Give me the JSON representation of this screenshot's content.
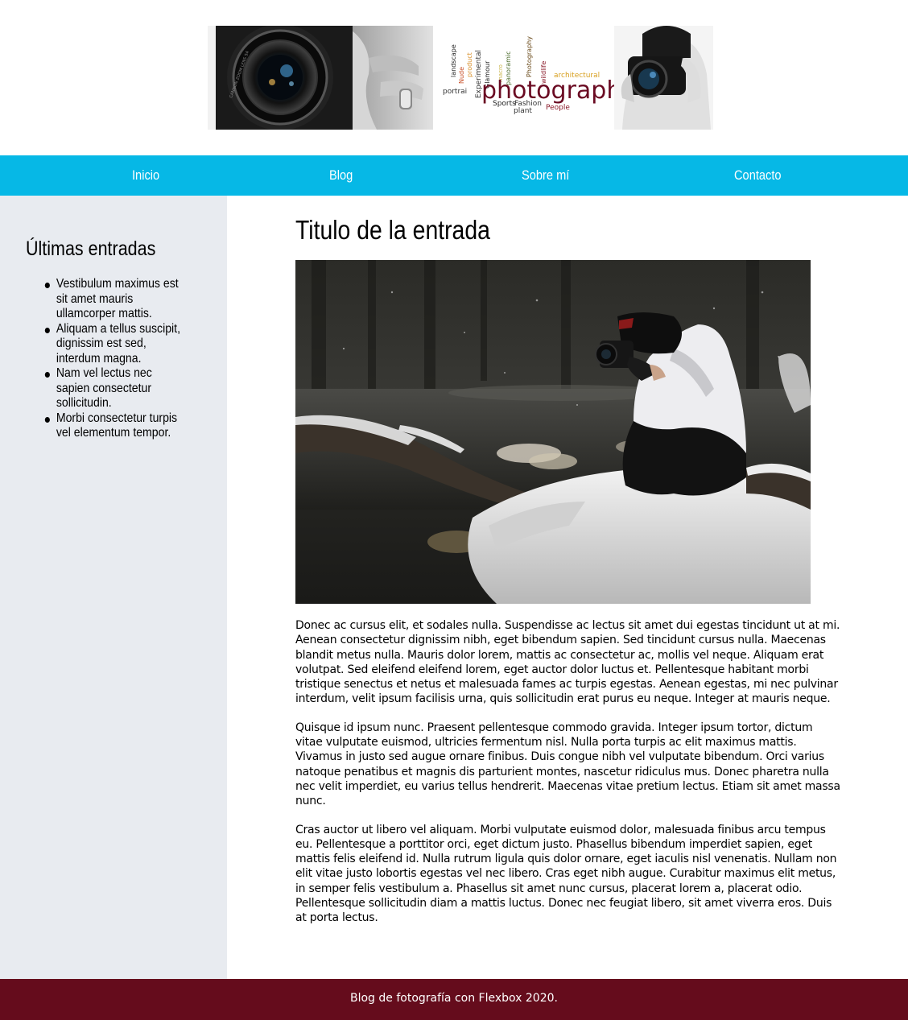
{
  "banner": {
    "alt": "photography banner",
    "word_cloud": [
      "landscape",
      "portrai",
      "Nude",
      "product",
      "Experimental",
      "Glamour",
      "macro",
      "panoramic",
      "Photography",
      "wildlife",
      "architectural",
      "photography",
      "Sports",
      "Fashion",
      "plant",
      "People"
    ],
    "lens_text": "CANNON ZOOM LENS 54"
  },
  "nav": {
    "items": [
      {
        "label": "Inicio"
      },
      {
        "label": "Blog"
      },
      {
        "label": "Sobre mí"
      },
      {
        "label": "Contacto"
      }
    ],
    "color": "#06b8e6"
  },
  "sidebar": {
    "title": "Últimas entradas",
    "items": [
      {
        "text": "Vestibulum maximus est sit amet mauris ullamcorper mattis."
      },
      {
        "text": "Aliquam a tellus suscipit, dignissim est sed, interdum magna."
      },
      {
        "text": "Nam vel lectus nec sapien consectetur sollicitudin."
      },
      {
        "text": "Morbi consectetur turpis vel elementum tempor."
      }
    ],
    "background": "#e8ebf0"
  },
  "post": {
    "title": "Titulo de la entrada",
    "image_alt": "photographer crouching on snowy log by a river",
    "paragraphs": [
      "Donec ac cursus elit, et sodales nulla. Suspendisse ac lectus sit amet dui egestas tincidunt ut at mi. Aenean consectetur dignissim nibh, eget bibendum sapien. Sed tincidunt cursus nulla. Maecenas blandit metus nulla. Mauris dolor lorem, mattis ac consectetur ac, mollis vel neque. Aliquam erat volutpat. Sed eleifend eleifend lorem, eget auctor dolor luctus et. Pellentesque habitant morbi tristique senectus et netus et malesuada fames ac turpis egestas. Aenean egestas, mi nec pulvinar interdum, velit ipsum facilisis urna, quis sollicitudin erat purus eu neque. Integer at mauris neque.",
      "Quisque id ipsum nunc. Praesent pellentesque commodo gravida. Integer ipsum tortor, dictum vitae vulputate euismod, ultricies fermentum nisl. Nulla porta turpis ac elit maximus mattis. Vivamus in justo sed augue ornare finibus. Duis congue nibh vel vulputate bibendum. Orci varius natoque penatibus et magnis dis parturient montes, nascetur ridiculus mus. Donec pharetra nulla nec velit imperdiet, eu varius tellus hendrerit. Maecenas vitae pretium lectus. Etiam sit amet massa nunc.",
      "Cras auctor ut libero vel aliquam. Morbi vulputate euismod dolor, malesuada finibus arcu tempus eu. Pellentesque a porttitor orci, eget dictum justo. Phasellus bibendum imperdiet sapien, eget mattis felis eleifend id. Nulla rutrum ligula quis dolor ornare, eget iaculis nisl venenatis. Nullam non elit vitae justo lobortis egestas vel nec libero. Cras eget nibh augue. Curabitur maximus elit metus, in semper felis vestibulum a. Phasellus sit amet nunc cursus, placerat lorem a, placerat odio. Pellentesque sollicitudin diam a mattis luctus. Donec nec feugiat libero, sit amet viverra eros. Duis at porta lectus."
    ]
  },
  "footer": {
    "text": "Blog de fotografía con Flexbox 2020.",
    "background": "#650c1c"
  }
}
